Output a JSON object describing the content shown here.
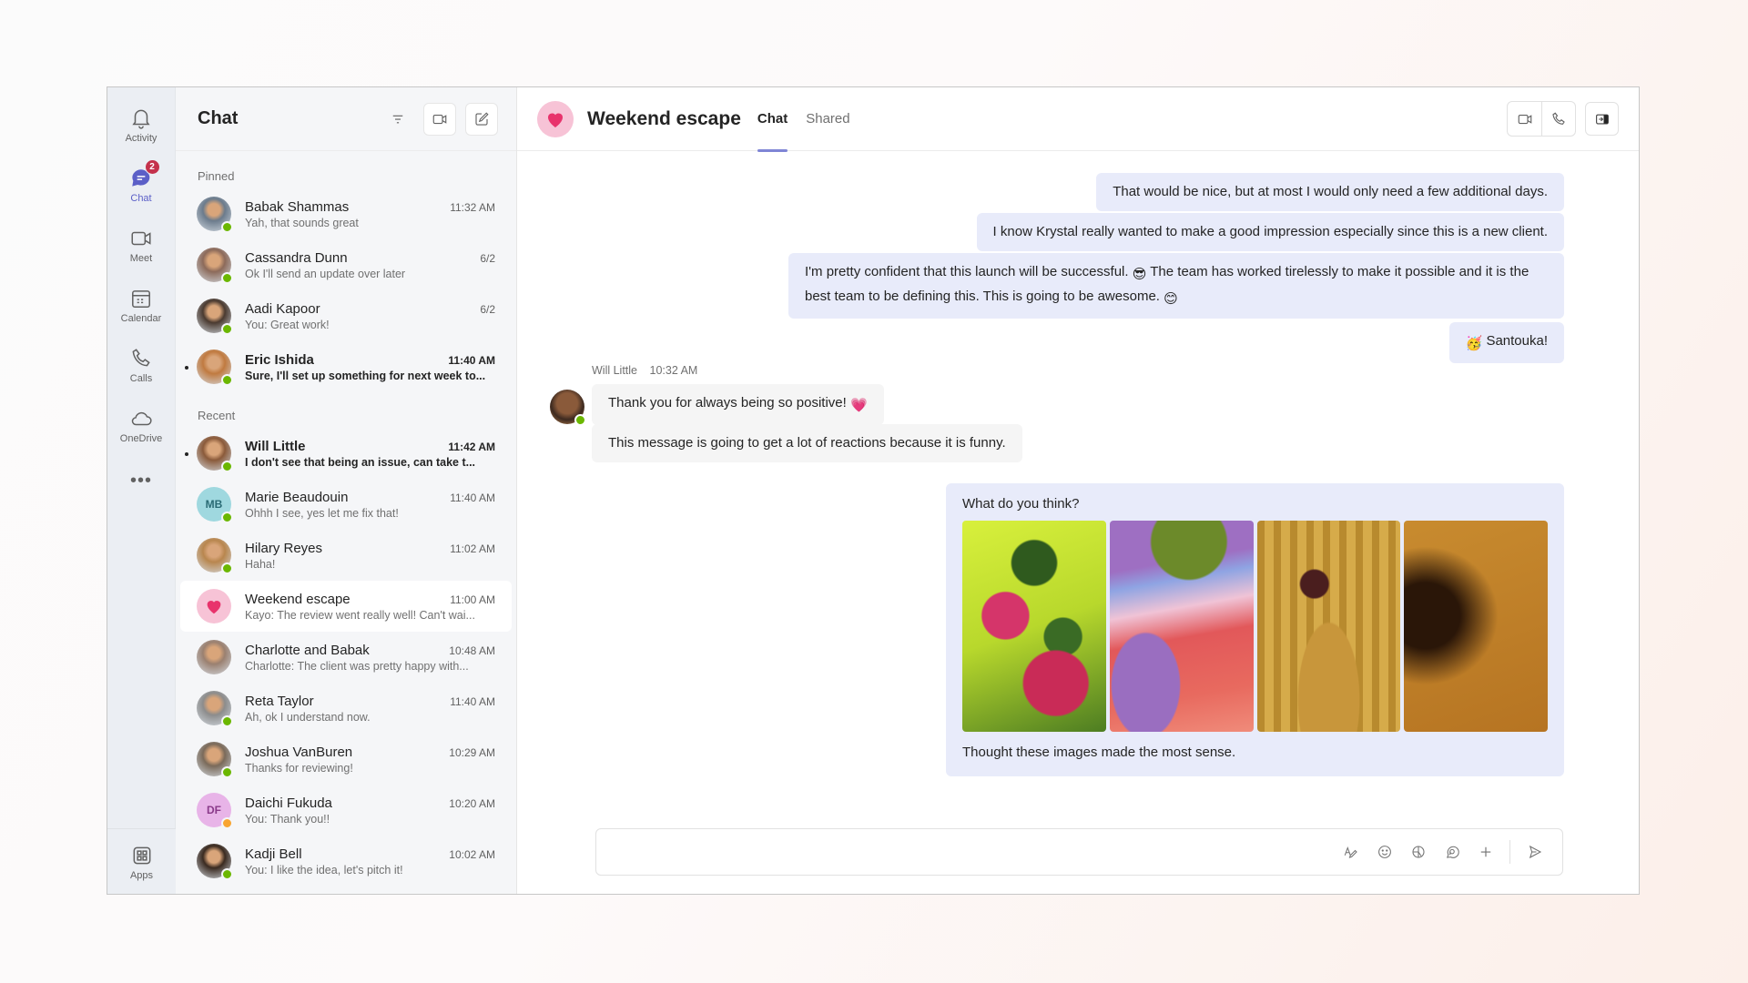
{
  "rail": {
    "items": [
      {
        "label": "Activity",
        "icon": "bell-icon"
      },
      {
        "label": "Chat",
        "icon": "chat-icon",
        "badge": "2",
        "active": true
      },
      {
        "label": "Meet",
        "icon": "video-icon"
      },
      {
        "label": "Calendar",
        "icon": "calendar-icon"
      },
      {
        "label": "Calls",
        "icon": "phone-icon"
      },
      {
        "label": "OneDrive",
        "icon": "cloud-icon"
      }
    ],
    "more_label": "•••",
    "apps_label": "Apps"
  },
  "chat_list": {
    "title": "Chat",
    "pinned_label": "Pinned",
    "recent_label": "Recent",
    "pinned": [
      {
        "name": "Babak Shammas",
        "time": "11:32 AM",
        "preview": "Yah, that sounds great",
        "avatar_color": "#6b7b8c",
        "presence": "#6bb700",
        "unread": false
      },
      {
        "name": "Cassandra Dunn",
        "time": "6/2",
        "preview": "Ok I'll send an update over later",
        "avatar_color": "#8c6a5a",
        "presence": "#6bb700",
        "unread": false
      },
      {
        "name": "Aadi Kapoor",
        "time": "6/2",
        "preview": "You: Great work!",
        "avatar_color": "#4a3a30",
        "presence": "#6bb700",
        "unread": false
      },
      {
        "name": "Eric Ishida",
        "time": "11:40 AM",
        "preview": "Sure, I'll set up something for next week to...",
        "avatar_color": "#c07a40",
        "presence": "#6bb700",
        "unread": true
      }
    ],
    "recent": [
      {
        "name": "Will Little",
        "time": "11:42 AM",
        "preview": "I don't see that being an issue, can take t...",
        "avatar_color": "#8a5a3a",
        "presence": "#6bb700",
        "unread": true
      },
      {
        "name": "Marie Beaudouin",
        "time": "11:40 AM",
        "preview": "Ohhh I see, yes let me fix that!",
        "initials": "MB",
        "avatar_color": "#9fd8df",
        "initials_color": "#2a6b75",
        "presence": "#6bb700",
        "unread": false
      },
      {
        "name": "Hilary Reyes",
        "time": "11:02 AM",
        "preview": "Haha!",
        "avatar_color": "#b8864e",
        "presence": "#6bb700",
        "unread": false
      },
      {
        "name": "Weekend escape",
        "time": "11:00 AM",
        "preview": "Kayo: The review went really well! Can't wai...",
        "group": true,
        "avatar_color": "#f7c3d6",
        "unread": false,
        "selected": true
      },
      {
        "name": "Charlotte and Babak",
        "time": "10:48 AM",
        "preview": "Charlotte: The client was pretty happy with...",
        "avatar_color": "#9a8070",
        "unread": false
      },
      {
        "name": "Reta Taylor",
        "time": "11:40 AM",
        "preview": "Ah, ok I understand now.",
        "avatar_color": "#8c8c8c",
        "presence": "#6bb700",
        "unread": false
      },
      {
        "name": "Joshua VanBuren",
        "time": "10:29 AM",
        "preview": "Thanks for reviewing!",
        "avatar_color": "#7a6a5a",
        "presence": "#6bb700",
        "unread": false
      },
      {
        "name": "Daichi Fukuda",
        "time": "10:20 AM",
        "preview": "You: Thank you!!",
        "initials": "DF",
        "avatar_color": "#e8b4e8",
        "initials_color": "#8a3a8a",
        "presence": "#f8a532",
        "unread": false
      },
      {
        "name": "Kadji Bell",
        "time": "10:02 AM",
        "preview": "You: I like the idea, let's pitch it!",
        "avatar_color": "#3a2a20",
        "presence": "#6bb700",
        "unread": false
      }
    ]
  },
  "conversation": {
    "title": "Weekend escape",
    "tabs": [
      {
        "label": "Chat",
        "active": true
      },
      {
        "label": "Shared",
        "active": false
      }
    ],
    "my_messages": [
      {
        "text": "That would be nice, but at most I would only need a few additional days."
      },
      {
        "text": "I know Krystal really wanted to make a good impression especially since this is a new client."
      },
      {
        "text_a": "I'm pretty confident that this launch will be successful.",
        "emoji_a": "😎",
        "text_b": "The team has worked tirelessly to make it possible and it is the best team to be defining this. This is going to be awesome.",
        "emoji_b": "😊"
      },
      {
        "emoji": "🥳",
        "text": "Santouka!"
      }
    ],
    "incoming": {
      "sender": "Will Little",
      "time": "10:32 AM",
      "messages": [
        {
          "text": "Thank you for always being so positive!",
          "emoji": "💗"
        },
        {
          "text": "This message is going to get a lot of reactions because it is funny."
        }
      ]
    },
    "image_card": {
      "title": "What do you think?",
      "images": [
        "roses-image",
        "landscape-image",
        "still-life-image",
        "orchid-image"
      ],
      "caption": "Thought these images made the most sense."
    },
    "composer": {
      "placeholder": "",
      "value": ""
    }
  },
  "colors": {
    "accent": "#5b5fc7",
    "my_bubble": "#e8ebfa",
    "their_bubble": "#f5f5f5",
    "badge": "#c4314b",
    "online": "#6bb700",
    "away": "#f8a532"
  }
}
